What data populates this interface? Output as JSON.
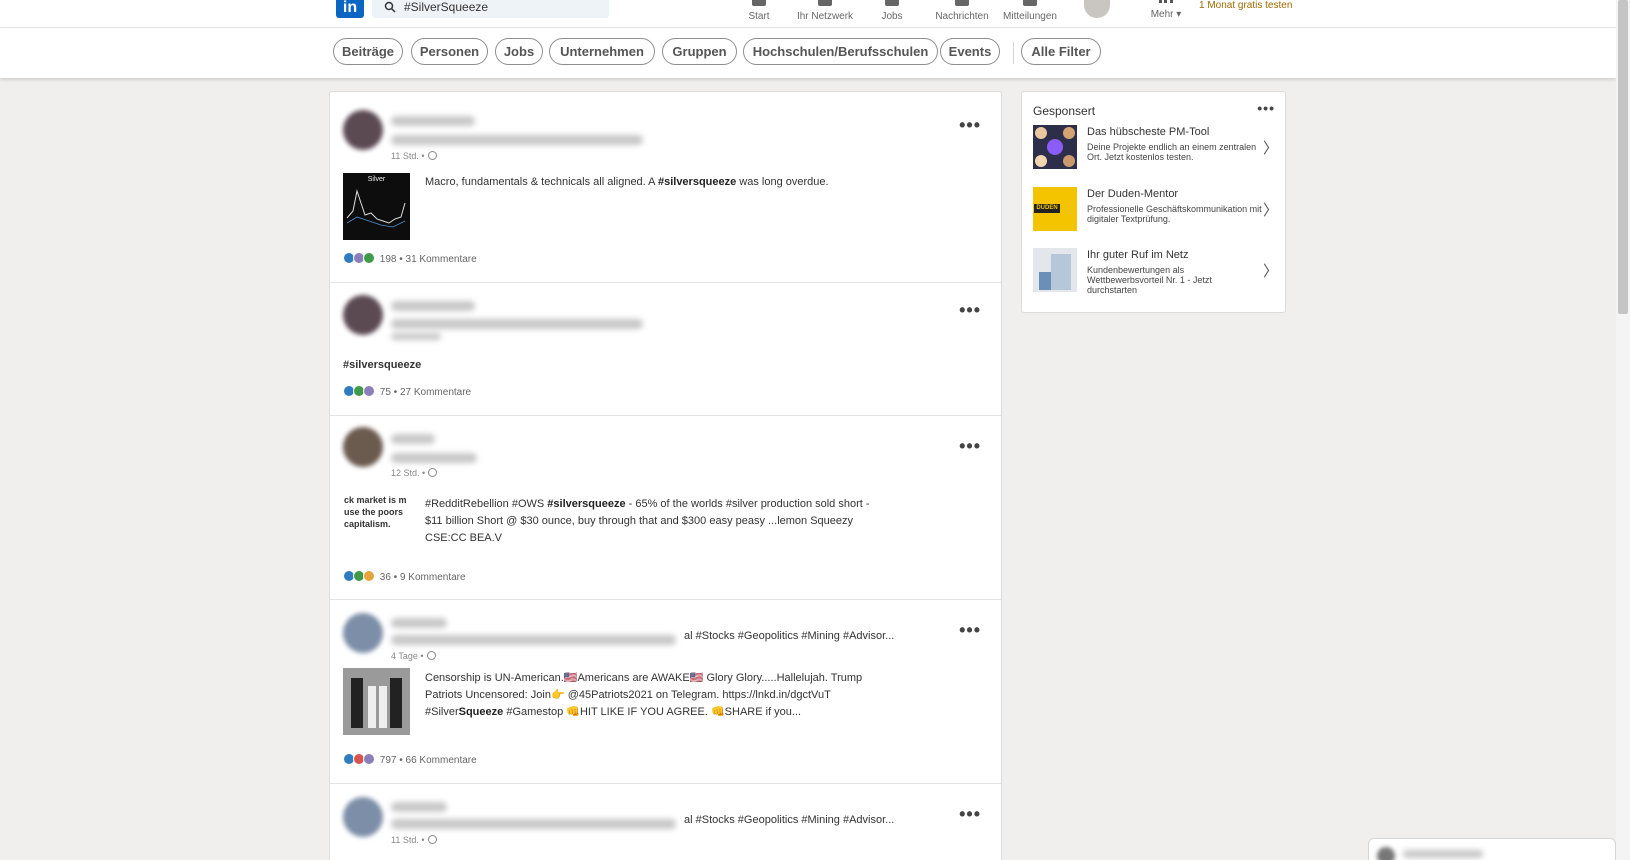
{
  "topnav": {
    "search_value": "#SilverSqueeze",
    "logo": "in",
    "items": [
      {
        "label": "Start",
        "icon": "home-icon"
      },
      {
        "label": "Ihr Netzwerk",
        "icon": "network-icon"
      },
      {
        "label": "Jobs",
        "icon": "briefcase-icon"
      },
      {
        "label": "Nachrichten",
        "icon": "messaging-icon"
      },
      {
        "label": "Mitteilungen",
        "icon": "bell-icon"
      }
    ],
    "more_label": "Mehr",
    "premium_label": "1 Monat gratis testen"
  },
  "filters": {
    "pills": [
      "Beiträge",
      "Personen",
      "Jobs",
      "Unternehmen",
      "Gruppen",
      "Hochschulen/Berufsschulen",
      "Events"
    ],
    "all_filters": "Alle Filter"
  },
  "posts": [
    {
      "time": "11 Std. •",
      "text_pre": "Macro, fundamentals & technicals all aligned. A ",
      "text_tag": "#silversqueeze",
      "text_post": " was long overdue.",
      "thumb_label": "Silver",
      "reactions": "198 • 31 Kommentare",
      "reaction_colors": [
        "#2f7dbf",
        "#8a7fb8",
        "#3f9a49"
      ]
    },
    {
      "time": "",
      "tag": "#silversqueeze",
      "reactions": "75 • 27 Kommentare",
      "reaction_colors": [
        "#2f7dbf",
        "#3f9a49",
        "#8a7fb8"
      ]
    },
    {
      "time": "12 Std. •",
      "text_line1_pre": "#RedditRebellion #OWS ",
      "text_line1_tag": "#silversqueeze",
      "text_line1_post": " - 65% of the worlds #silver production sold short -",
      "text_line2": "$11 billion Short @ $30 ounce, buy through that and $300 easy peasy ...lemon Squeezy",
      "text_line3": "CSE:CC BEA.V",
      "thumb_line1": "ck market is m",
      "thumb_line2": "use the poors",
      "thumb_line3": "capitalism.",
      "reactions": "36 • 9 Kommentare",
      "reaction_colors": [
        "#2f7dbf",
        "#3f9a49",
        "#e6a43b"
      ]
    },
    {
      "time": "4 Tage •",
      "hashtags": "al #Stocks #Geopolitics #Mining #Advisor...",
      "text_line1": "Censorship is UN-American.🇺🇸Americans are AWAKE🇺🇸 Glory Glory.....Hallelujah. Trump",
      "text_line2": "Patriots Uncensored: Join👉 @45Patriots2021 on Telegram. https://lnkd.in/dgctVuT",
      "text_line3_a": "#Silver",
      "text_line3_b": "Squeeze",
      "text_line3_c": " #Game",
      "text_line3_d": "stop 👊HIT LIKE IF YOU AGREE. 👊SHARE if you...",
      "reactions": "797 • 66 Kommentare",
      "reaction_colors": [
        "#2f7dbf",
        "#d9534f",
        "#8a7fb8"
      ]
    },
    {
      "time": "11 Std. •",
      "hashtags": "al #Stocks #Geopolitics #Mining #Advisor..."
    }
  ],
  "sponsored": {
    "title": "Gesponsert",
    "items": [
      {
        "head": "Das hübscheste PM-Tool",
        "desc": "Deine Projekte endlich an einem zentralen Ort. Jetzt kostenlos testen."
      },
      {
        "head": "Der Duden-Mentor",
        "desc": "Professionelle Geschäftskommunikation mit digitaler Textprüfung.",
        "logo_text": "DUDEN"
      },
      {
        "head": "Ihr guter Ruf im Netz",
        "desc": "Kundenbewertungen als Wettbewerbsvorteil Nr. 1 - Jetzt durchstarten"
      }
    ]
  },
  "colors": {
    "brand": "#0a66c2",
    "premium": "#a06a00",
    "duden_yellow": "#f5c400"
  }
}
